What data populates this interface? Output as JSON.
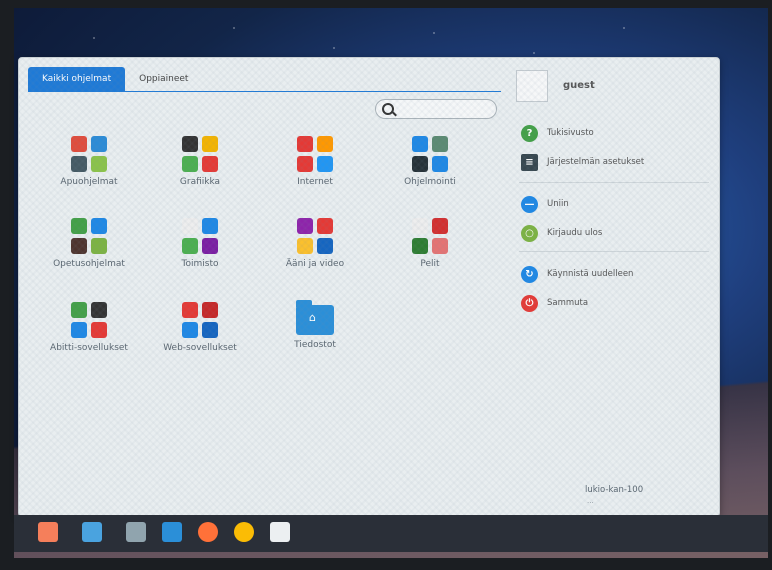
{
  "tabs": [
    {
      "label": "Kaikki ohjelmat",
      "active": true
    },
    {
      "label": "Oppiaineet",
      "active": false
    }
  ],
  "search": {
    "placeholder": "",
    "icon": "search-icon"
  },
  "categories": [
    {
      "label": "Apuohjelmat",
      "colors": [
        "#e04c3c",
        "#2c8bd6",
        "#455a64",
        "#8bc34a"
      ]
    },
    {
      "label": "Grafiikka",
      "colors": [
        "#333333",
        "#f4b400",
        "#4caf50",
        "#e53935"
      ]
    },
    {
      "label": "Internet",
      "colors": [
        "#e53935",
        "#ff9800",
        "#e53935",
        "#2196f3"
      ]
    },
    {
      "label": "Ohjelmointi",
      "colors": [
        "#1e88e5",
        "#5b8a72",
        "#263238",
        "#1e88e5"
      ]
    },
    {
      "label": "Opetusohjelmat",
      "colors": [
        "#43a047",
        "#1e88e5",
        "#4e342e",
        "#7cb342"
      ]
    },
    {
      "label": "Toimisto",
      "colors": [
        "#eeeeee",
        "#1e88e5",
        "#4caf50",
        "#7b1fa2"
      ]
    },
    {
      "label": "Ääni ja video",
      "colors": [
        "#8e24aa",
        "#e53935",
        "#fbc02d",
        "#1565c0"
      ]
    },
    {
      "label": "Pelit",
      "colors": [
        "#eeeeee",
        "#d32f2f",
        "#2e7d32",
        "#e57373"
      ]
    },
    {
      "label": "Abitti-sovellukset",
      "colors": [
        "#43a047",
        "#333333",
        "#1e88e5",
        "#e53935"
      ]
    },
    {
      "label": "Web-sovellukset",
      "colors": [
        "#e53935",
        "#c62828",
        "#1e88e5",
        "#1565c0"
      ]
    },
    {
      "label": "Tiedostot",
      "colors": []
    }
  ],
  "user": {
    "name": "guest"
  },
  "right_menu": [
    {
      "label": "Tukisivusto",
      "icon": "help-icon",
      "color": "#43a047",
      "glyph": "?"
    },
    {
      "label": "Järjestelmän asetukset",
      "icon": "settings-icon",
      "color": "#37474f",
      "glyph": "≡"
    },
    {
      "label": "Uniin",
      "icon": "sleep-icon",
      "color": "#1e88e5",
      "glyph": "—"
    },
    {
      "label": "Kirjaudu ulos",
      "icon": "logout-icon",
      "color": "#7cb342",
      "glyph": "○"
    },
    {
      "label": "Käynnistä uudelleen",
      "icon": "restart-icon",
      "color": "#1e88e5",
      "glyph": "↻"
    },
    {
      "label": "Sammuta",
      "icon": "power-icon",
      "color": "#e53935",
      "glyph": "⏻"
    }
  ],
  "host": {
    "name": "lukio-kan-100",
    "sub": "..."
  },
  "taskbar": [
    {
      "name": "menu-icon",
      "color": "#f57f5b"
    },
    {
      "name": "desktop-icon",
      "color": "#4aa3df"
    },
    {
      "name": "windows-icon",
      "color": "#90a4ae"
    },
    {
      "name": "files-icon",
      "color": "#2b8fd8"
    },
    {
      "name": "firefox-icon",
      "color": "#ff7139"
    },
    {
      "name": "chrome-icon",
      "color": "#fbbc05"
    },
    {
      "name": "document-icon",
      "color": "#eceff1"
    }
  ],
  "colors": {
    "accent": "#1f7ad6"
  }
}
